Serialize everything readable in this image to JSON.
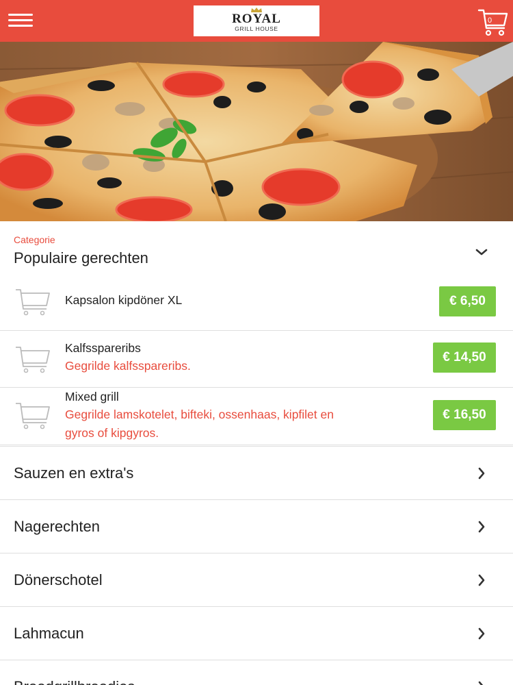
{
  "header": {
    "menu_icon": "hamburger-menu-icon",
    "logo_name": "ROYAL",
    "logo_sub": "GRILL HOUSE",
    "cart_icon": "shopping-cart-icon",
    "cart_count": "0",
    "color": "#e84c3d"
  },
  "hero": {
    "description_icon": "pizza-hero-image"
  },
  "category": {
    "label": "Categorie",
    "name": "Populaire gerechten",
    "toggle_icon": "chevron-down-icon"
  },
  "products": [
    {
      "name": "Kapsalon kipdöner XL",
      "description": "",
      "price": "€ 6,50"
    },
    {
      "name": "Kalfsspareribs",
      "description": "Gegrilde kalfsspareribs.",
      "price": "€ 14,50"
    },
    {
      "name": "Mixed grill",
      "description_line1": "Gegrilde lamskotelet, bifteki, ossenhaas, kipfilet en",
      "description_line2": "gyros of kipgyros.",
      "price": "€ 16,50"
    }
  ],
  "categories": [
    {
      "label": "Sauzen en extra's"
    },
    {
      "label": "Nagerechten"
    },
    {
      "label": "Dönerschotel"
    },
    {
      "label": "Lahmacun"
    },
    {
      "label": "Broodgrillbroodjes"
    }
  ],
  "colors": {
    "accent": "#e84c3d",
    "price": "#7ac943"
  }
}
